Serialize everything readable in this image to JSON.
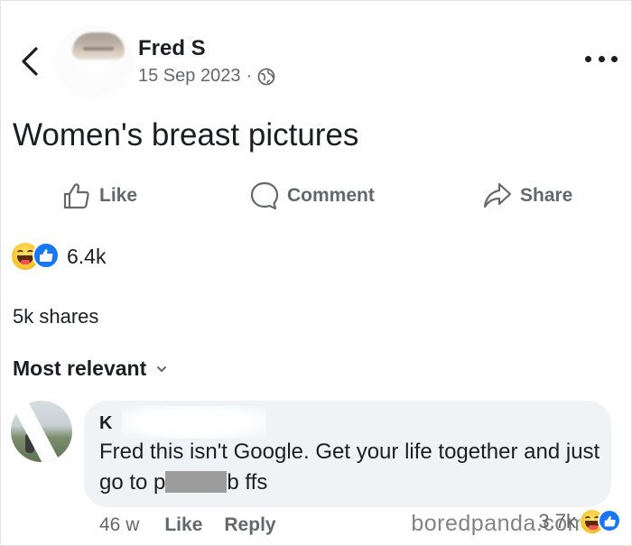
{
  "post": {
    "author": "Fred S",
    "date": "15 Sep 2023",
    "separator": "·",
    "privacy_icon": "globe-icon",
    "text": "Women's breast pictures"
  },
  "actions": {
    "like_label": "Like",
    "comment_label": "Comment",
    "share_label": "Share"
  },
  "engagement": {
    "reaction_icons": [
      "haha-reaction-icon",
      "like-reaction-icon"
    ],
    "reactions_count": "6.4k",
    "shares": "5k shares"
  },
  "sort": {
    "label": "Most relevant",
    "icon": "chevron-down-icon"
  },
  "comment": {
    "author": "K",
    "text_before_censor": "Fred this isn't Google. Get your life together and just go to p",
    "text_after_censor": "b ffs",
    "time": "46 w",
    "like_label": "Like",
    "reply_label": "Reply",
    "reactions_count": "3.7k",
    "reaction_icons": [
      "haha-reaction-icon",
      "like-reaction-icon"
    ]
  },
  "watermark": "boredpanda.com",
  "colors": {
    "accent_blue": "#1877f2",
    "secondary_text": "#65676b",
    "primary_text": "#1c1e21",
    "bubble_bg": "#f0f2f5"
  }
}
